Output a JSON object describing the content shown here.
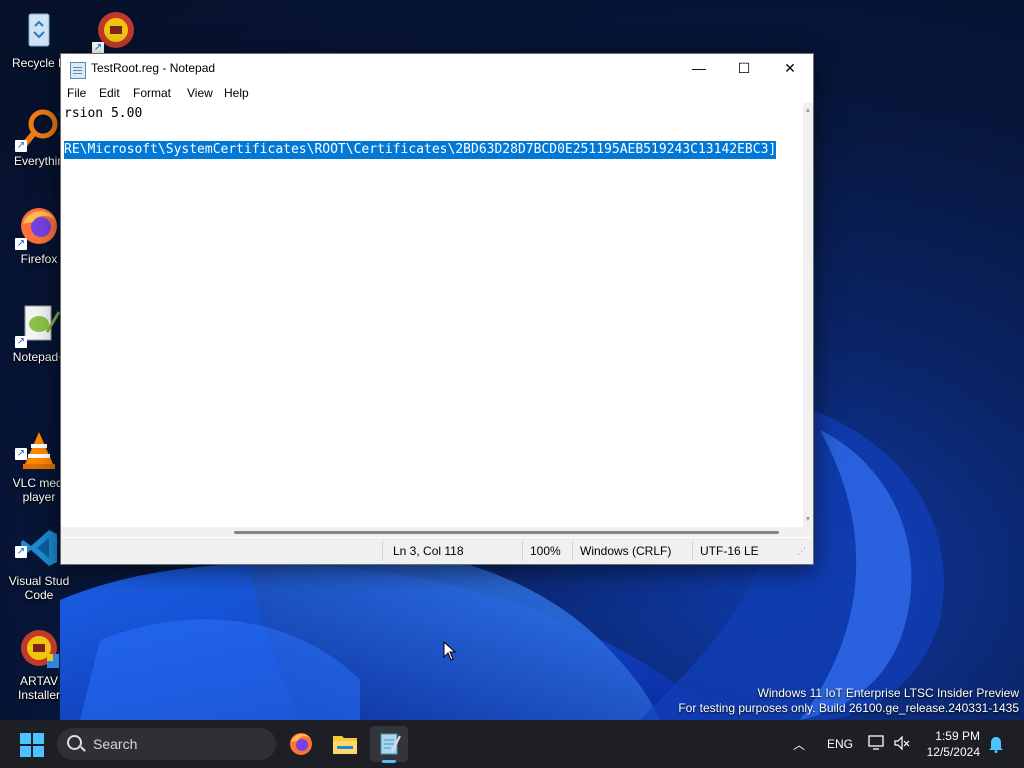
{
  "desktop": {
    "icons": [
      {
        "label": "Recycle B",
        "icon": "recycle-bin-icon"
      },
      {
        "label": "Everythin",
        "icon": "everything-search-icon"
      },
      {
        "label": "Firefox",
        "icon": "firefox-icon"
      },
      {
        "label": "Notepad+",
        "icon": "notepadpp-icon"
      },
      {
        "label": "VLC medi\nplayer",
        "icon": "vlc-icon"
      },
      {
        "label": "Visual Stud\nCode",
        "icon": "vscode-icon"
      },
      {
        "label": "ARTAV\nInstaller",
        "icon": "artav-icon"
      }
    ],
    "watermark": {
      "line1": "Windows 11 IoT Enterprise LTSC Insider Preview",
      "line2": "For testing purposes only. Build 26100.ge_release.240331-1435"
    }
  },
  "window": {
    "title": "TestRoot.reg - Notepad",
    "controls": {
      "minimize": "—",
      "maximize": "☐",
      "close": "✕"
    },
    "menu": [
      "File",
      "Edit",
      "Format",
      "View",
      "Help"
    ],
    "lines": [
      "rsion 5.00",
      "",
      "RE\\Microsoft\\SystemCertificates\\ROOT\\Certificates\\2BD63D28D7BCD0E251195AEB519243C13142EBC3]"
    ],
    "selected_line_index": 2,
    "status": {
      "position": "Ln 3, Col 118",
      "zoom": "100%",
      "line_ending": "Windows (CRLF)",
      "encoding": "UTF-16 LE"
    }
  },
  "taskbar": {
    "search_placeholder": "Search",
    "apps": [
      "firefox-icon",
      "file-explorer-icon",
      "notepad-icon"
    ],
    "tray": {
      "language": "ENG",
      "time": "1:59 PM",
      "date": "12/5/2024"
    }
  },
  "colors": {
    "selection": "#0078d7",
    "accent": "#4cc2ff",
    "taskbar": "#1e1f24"
  }
}
